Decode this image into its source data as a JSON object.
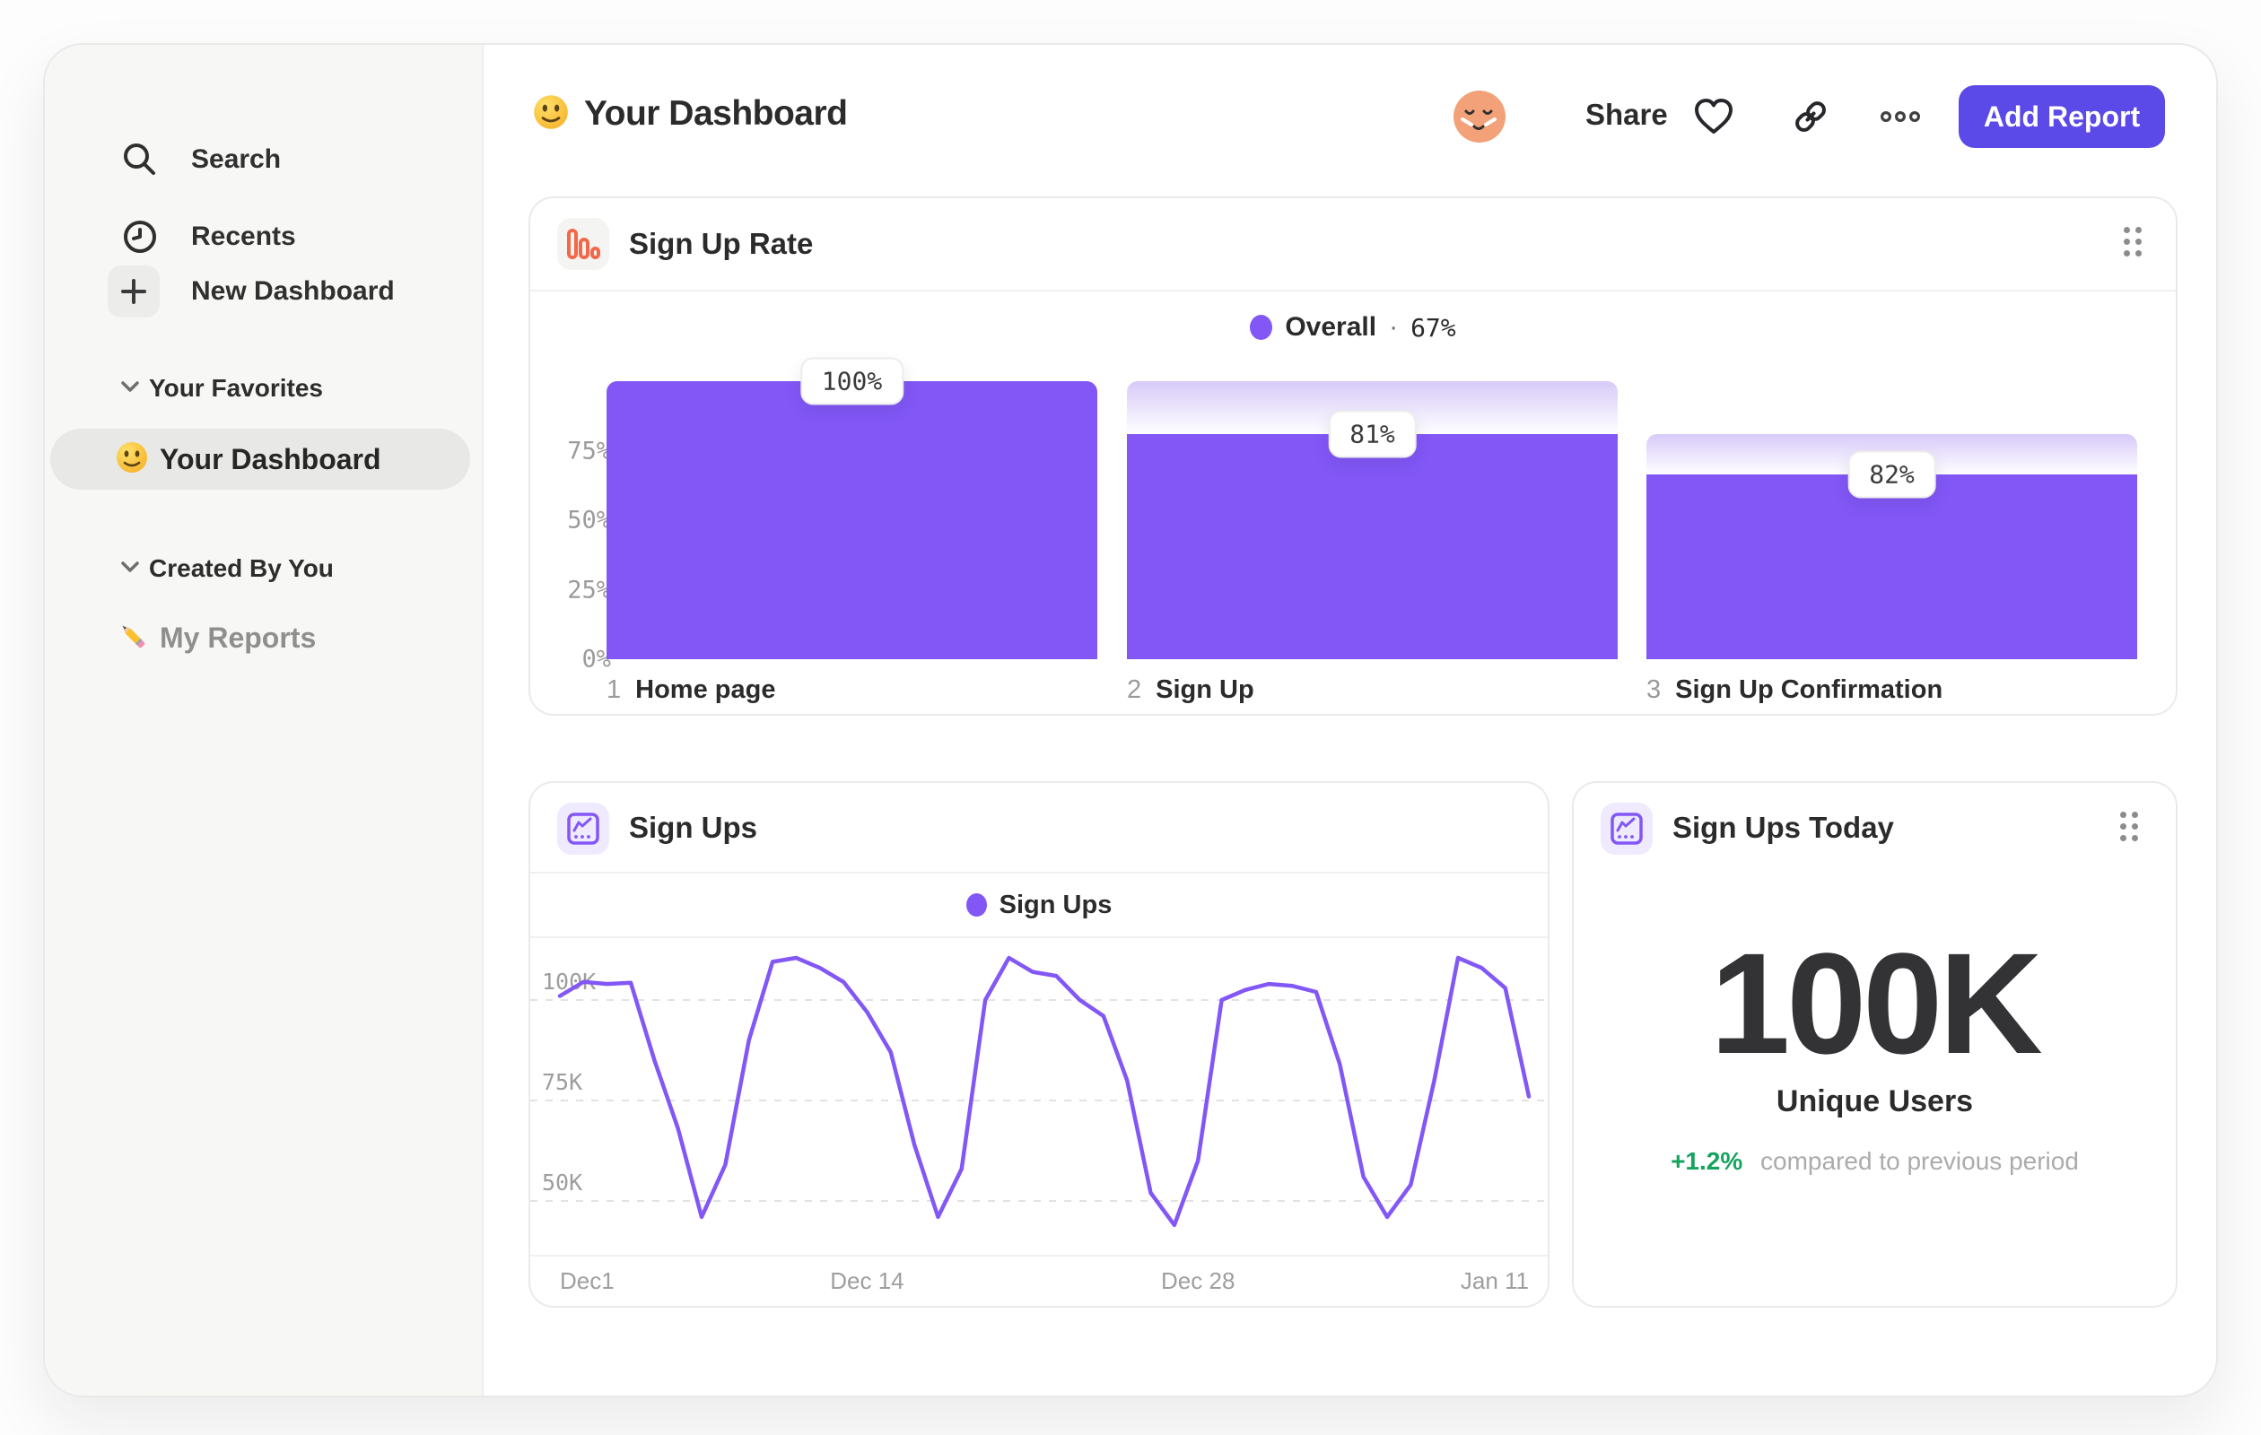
{
  "sidebar": {
    "top_items": [
      {
        "label": "Search"
      },
      {
        "label": "Recents"
      },
      {
        "label": "New Dashboard"
      }
    ],
    "sections": [
      {
        "label": "Your Favorites",
        "items": [
          {
            "label": "Your Dashboard",
            "active": true
          }
        ]
      },
      {
        "label": "Created By You",
        "items": [
          {
            "label": "My Reports",
            "active": false
          }
        ]
      }
    ]
  },
  "header": {
    "title": "Your Dashboard",
    "share": "Share",
    "add_report": "Add Report"
  },
  "cards": {
    "funnel": {
      "title": "Sign Up Rate",
      "legend_name": "Overall",
      "legend_sep": "·",
      "legend_value": "67%"
    },
    "line": {
      "title": "Sign Ups",
      "legend_name": "Sign Ups"
    },
    "metric": {
      "title": "Sign Ups Today",
      "value": "100K",
      "unit_label": "Unique Users",
      "delta": "+1.2%",
      "delta_note": "compared to previous period"
    }
  },
  "chart_data": [
    {
      "type": "bar",
      "variant": "funnel",
      "title": "Sign Up Rate",
      "categories": [
        "Home page",
        "Sign Up",
        "Sign Up Confirmation"
      ],
      "step_numbers": [
        "1",
        "2",
        "3"
      ],
      "step_conversion_pct": [
        100,
        81,
        82
      ],
      "badge_labels": [
        "100%",
        "81%",
        "82%"
      ],
      "values_cumulative_pct": [
        100,
        81,
        66.4
      ],
      "overall_label": "Overall",
      "overall_value_pct": 67,
      "y_ticks": [
        {
          "label": "75%",
          "value": 75
        },
        {
          "label": "50%",
          "value": 50
        },
        {
          "label": "25%",
          "value": 25
        },
        {
          "label": "0%",
          "value": 0
        }
      ],
      "ylim": [
        0,
        100
      ],
      "grid": false,
      "legend_position": "top-center"
    },
    {
      "type": "line",
      "title": "Sign Ups",
      "series": [
        {
          "name": "Sign Ups",
          "unit": "K",
          "values": [
            101,
            104.5,
            104,
            104.3,
            85,
            68,
            46,
            59,
            90,
            109.5,
            110.5,
            108,
            104.5,
            97,
            87,
            64,
            46,
            58,
            100,
            110.5,
            107,
            106,
            100,
            96,
            80,
            52,
            44,
            60,
            100,
            102.5,
            104,
            103.5,
            102,
            84,
            56,
            46,
            54,
            80,
            110.5,
            108,
            103,
            76
          ]
        }
      ],
      "x_start_label": "Dec1",
      "x_tick_labels": [
        "Dec1",
        "Dec 14",
        "Dec 28",
        "Jan 11"
      ],
      "x_tick_days": [
        0,
        13,
        27,
        41
      ],
      "y_ticks": [
        {
          "label": "100K",
          "value": 100
        },
        {
          "label": "75K",
          "value": 75
        },
        {
          "label": "50K",
          "value": 50
        }
      ],
      "ylim": [
        36.6,
        115.4
      ],
      "grid": "dashed-horizontal",
      "legend_position": "top-center"
    }
  ],
  "colors": {
    "accent_purple": "#8257F6",
    "funnel_gradient_top": "#D7CAF9",
    "button_indigo": "#5B49E8",
    "icon_orange": "#F26849",
    "green_positive": "#16A35F",
    "axis_gray": "#9B9B9B"
  }
}
